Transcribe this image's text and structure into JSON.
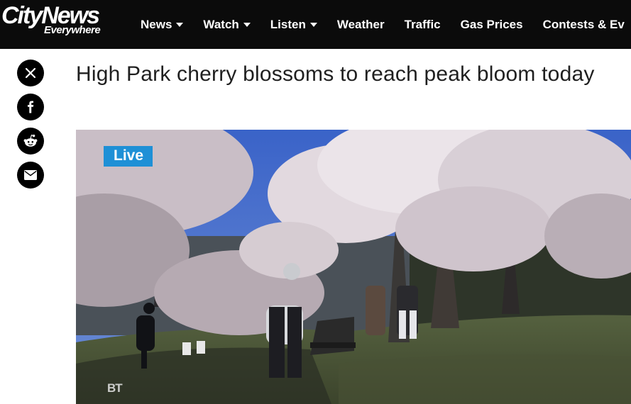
{
  "brand": {
    "logo_main": "CityNews",
    "logo_sub": "Everywhere"
  },
  "nav": {
    "items": [
      {
        "label": "News",
        "dropdown": true
      },
      {
        "label": "Watch",
        "dropdown": true
      },
      {
        "label": "Listen",
        "dropdown": true
      },
      {
        "label": "Weather",
        "dropdown": false
      },
      {
        "label": "Traffic",
        "dropdown": false
      },
      {
        "label": "Gas Prices",
        "dropdown": false
      },
      {
        "label": "Contests & Ev",
        "dropdown": false
      }
    ]
  },
  "share": {
    "icons": [
      "x-icon",
      "facebook-icon",
      "reddit-icon",
      "email-icon"
    ]
  },
  "article": {
    "headline": "High Park cherry blossoms to reach peak bloom today"
  },
  "video": {
    "live_badge": "Live",
    "watermark": "BT"
  },
  "colors": {
    "topbar": "#0b0b0b",
    "live_badge": "#1e90d6",
    "headline": "#1f1f1f"
  }
}
